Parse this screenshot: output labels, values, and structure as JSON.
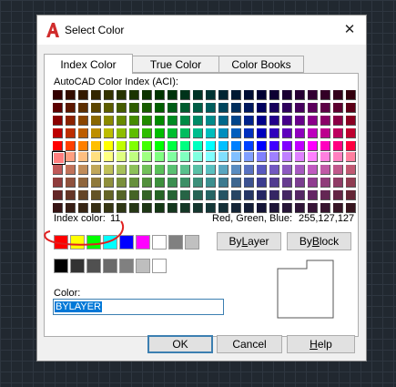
{
  "window": {
    "title": "Select Color",
    "close_glyph": "✕",
    "app_icon": "autocad-a-icon",
    "accent": "#d02c2c"
  },
  "tabs": [
    {
      "label": "Index Color",
      "active": true
    },
    {
      "label": "True Color",
      "active": false
    },
    {
      "label": "Color Books",
      "active": false
    }
  ],
  "aci": {
    "label": "AutoCAD Color Index (ACI):",
    "index_label": "Index color:",
    "index_value": "11",
    "rgb_label": "Red, Green, Blue:",
    "rgb_value": "255,127,127",
    "selected_color": "#ff7f7f"
  },
  "standard_colors": [
    "#ff0000",
    "#ffff00",
    "#00ff00",
    "#00ffff",
    "#0000ff",
    "#ff00ff",
    "#ffffff",
    "#808080",
    "#c0c0c0"
  ],
  "gray_colors": [
    "#000000",
    "#333333",
    "#505050",
    "#696969",
    "#808080",
    "#bebebe",
    "#ffffff"
  ],
  "buttons": {
    "bylayer": {
      "label_pre": "By",
      "label_u": "L",
      "label_post": "ayer"
    },
    "byblock": {
      "label_pre": "By",
      "label_u": "B",
      "label_post": "lock"
    },
    "ok": "OK",
    "cancel": "Cancel",
    "help_u": "H",
    "help_rest": "elp"
  },
  "color_field": {
    "label": "Color:",
    "value": "BYLAYER"
  },
  "annotation": {
    "color": "#e02020"
  }
}
